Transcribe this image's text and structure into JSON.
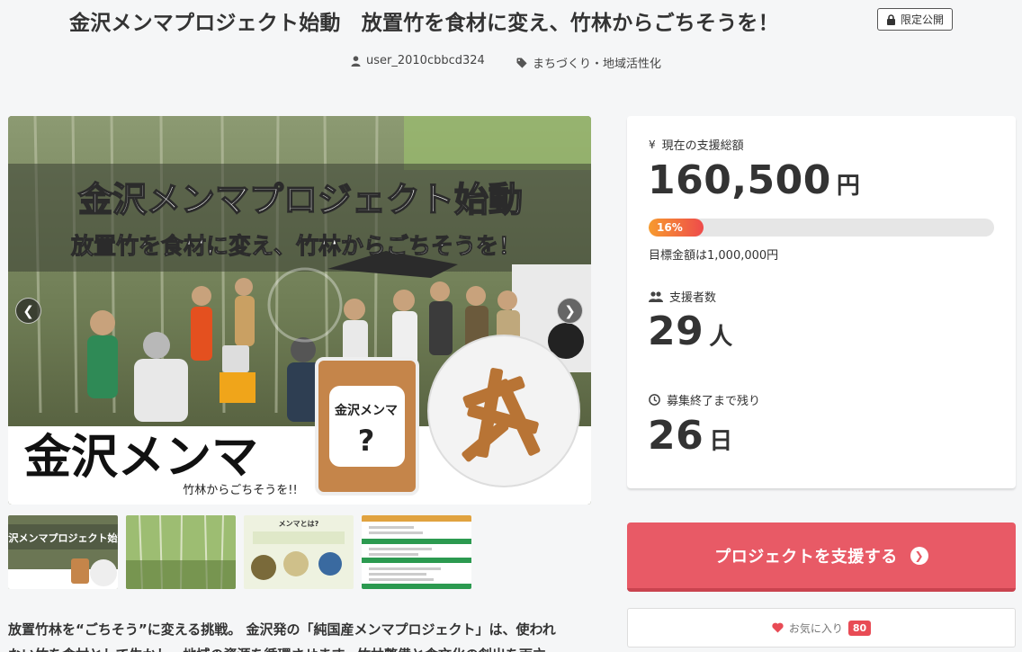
{
  "project": {
    "title": "金沢メンマプロジェクト始動　放置竹を食材に変え、竹林からごちそうを！",
    "visibility_badge": "限定公開",
    "author": "user_2010cbbcd324",
    "category": "まちづくり・地域活性化"
  },
  "hero": {
    "headline": "金沢メンマプロジェクト始動",
    "subheadline": "放置竹を食材に変え、竹林からごちそうを！",
    "logo_text": "金沢メンマ",
    "logo_tagline": "竹林からごちそうを!!",
    "package_label": "金沢メンマ",
    "package_mark": "?"
  },
  "thumbnails": [
    {
      "caption": "金沢メンマプロジェクト始動"
    },
    {
      "caption": ""
    },
    {
      "caption": "メンマとは?"
    },
    {
      "caption": ""
    }
  ],
  "stats": {
    "total_label": "現在の支援総額",
    "total_value": "160,500",
    "total_unit": "円",
    "progress_percent_label": "16%",
    "progress_fraction": 0.16,
    "goal_text": "目標金額は1,000,000円",
    "supporters_label": "支援者数",
    "supporters_value": "29",
    "supporters_unit": "人",
    "remaining_label": "募集終了まで残り",
    "remaining_value": "26",
    "remaining_unit": "日"
  },
  "actions": {
    "support_label": "プロジェクトを支援する",
    "favorite_label": "お気に入り",
    "favorite_count": "80"
  },
  "description": {
    "line1": "放置竹林を“ごちそう”に変える挑戦。 金沢発の「純国産メンマプロジェクト」は、使われ",
    "line2": "ない竹を食材として生かし、地域の資源を循環させます。竹林整備と食文化の創出を両立"
  },
  "colors": {
    "accent": "#e85a66",
    "progress_start": "#f79b2e",
    "progress_end": "#ee4b4b",
    "badge_red": "#e84b55"
  }
}
